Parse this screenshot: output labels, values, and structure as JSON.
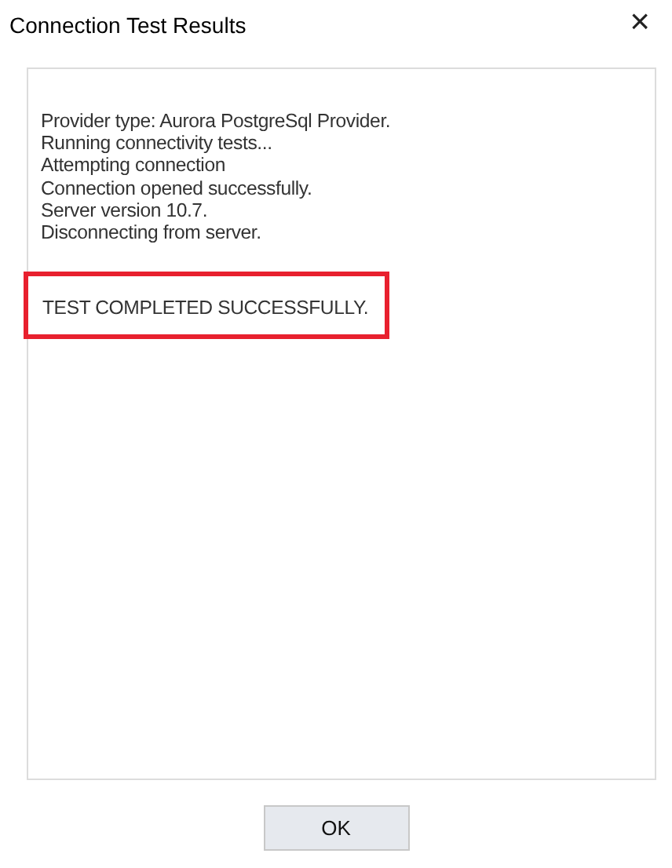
{
  "window": {
    "title": "Connection Test Results",
    "close": "×"
  },
  "log_lines": [
    "Provider type: Aurora PostgreSql Provider.",
    "Running connectivity tests...",
    "Attempting connection",
    "Connection opened successfully.",
    "Server version 10.7.",
    "Disconnecting from server."
  ],
  "result": {
    "text": "TEST COMPLETED SUCCESSFULLY.",
    "highlighted": true
  },
  "buttons": [
    "OK"
  ]
}
